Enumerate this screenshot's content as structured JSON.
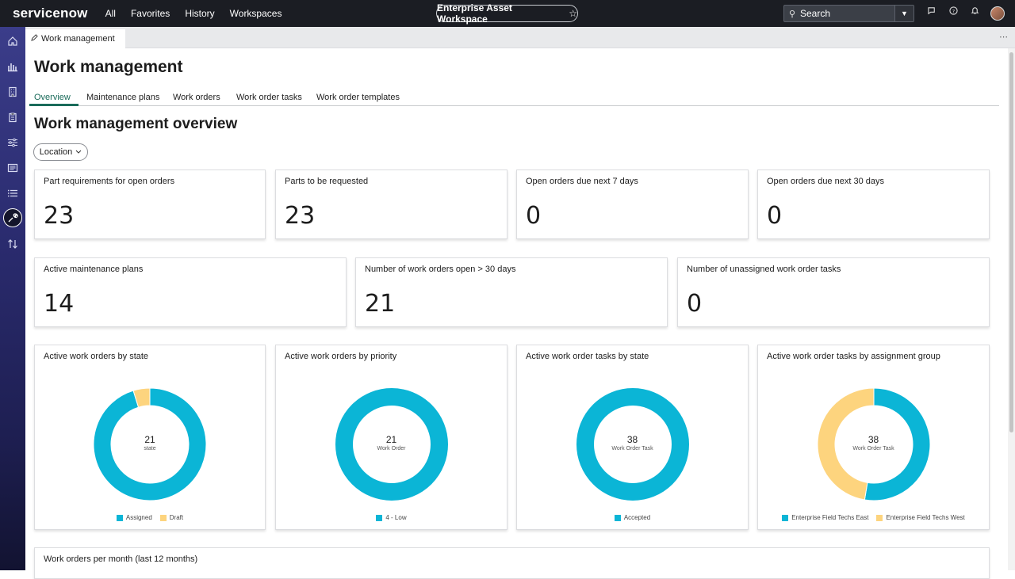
{
  "app": {
    "logo": "servicenow",
    "nav": [
      "All",
      "Favorites",
      "History",
      "Workspaces"
    ],
    "workspace": "Enterprise Asset Workspace",
    "search_label": "Search"
  },
  "tab": {
    "label": "Work management"
  },
  "page": {
    "title": "Work management",
    "tabs": [
      "Overview",
      "Maintenance plans",
      "Work orders",
      "Work order tasks",
      "Work order templates"
    ],
    "section_title": "Work management overview",
    "filter_label": "Location"
  },
  "stats_row1": [
    {
      "title": "Part requirements for open orders",
      "value": "23"
    },
    {
      "title": "Parts to be requested",
      "value": "23"
    },
    {
      "title": "Open orders due next 7 days",
      "value": "0"
    },
    {
      "title": "Open orders due next 30 days",
      "value": "0"
    }
  ],
  "stats_row2": [
    {
      "title": "Active maintenance plans",
      "value": "14"
    },
    {
      "title": "Number of work orders open > 30 days",
      "value": "21"
    },
    {
      "title": "Number of unassigned work order tasks",
      "value": "0"
    }
  ],
  "chart_data": [
    {
      "type": "pie",
      "title": "Active work orders by state",
      "center_value": "21",
      "center_label": "state",
      "categories": [
        "Assigned",
        "Draft"
      ],
      "values": [
        20,
        1
      ],
      "colors": [
        "#0bb5d6",
        "#fdd47e"
      ]
    },
    {
      "type": "pie",
      "title": "Active work orders by priority",
      "center_value": "21",
      "center_label": "Work Order",
      "categories": [
        "4 - Low"
      ],
      "values": [
        21
      ],
      "colors": [
        "#0bb5d6"
      ]
    },
    {
      "type": "pie",
      "title": "Active work order tasks by state",
      "center_value": "38",
      "center_label": "Work Order Task",
      "categories": [
        "Accepted"
      ],
      "values": [
        38
      ],
      "colors": [
        "#0bb5d6"
      ]
    },
    {
      "type": "pie",
      "title": "Active work order tasks by assignment group",
      "center_value": "38",
      "center_label": "Work Order Task",
      "categories": [
        "Enterprise Field Techs East",
        "Enterprise Field Techs West"
      ],
      "values": [
        20,
        18
      ],
      "colors": [
        "#0bb5d6",
        "#fdd47e"
      ]
    }
  ],
  "bottom_card": {
    "title": "Work orders per month (last 12 months)"
  }
}
